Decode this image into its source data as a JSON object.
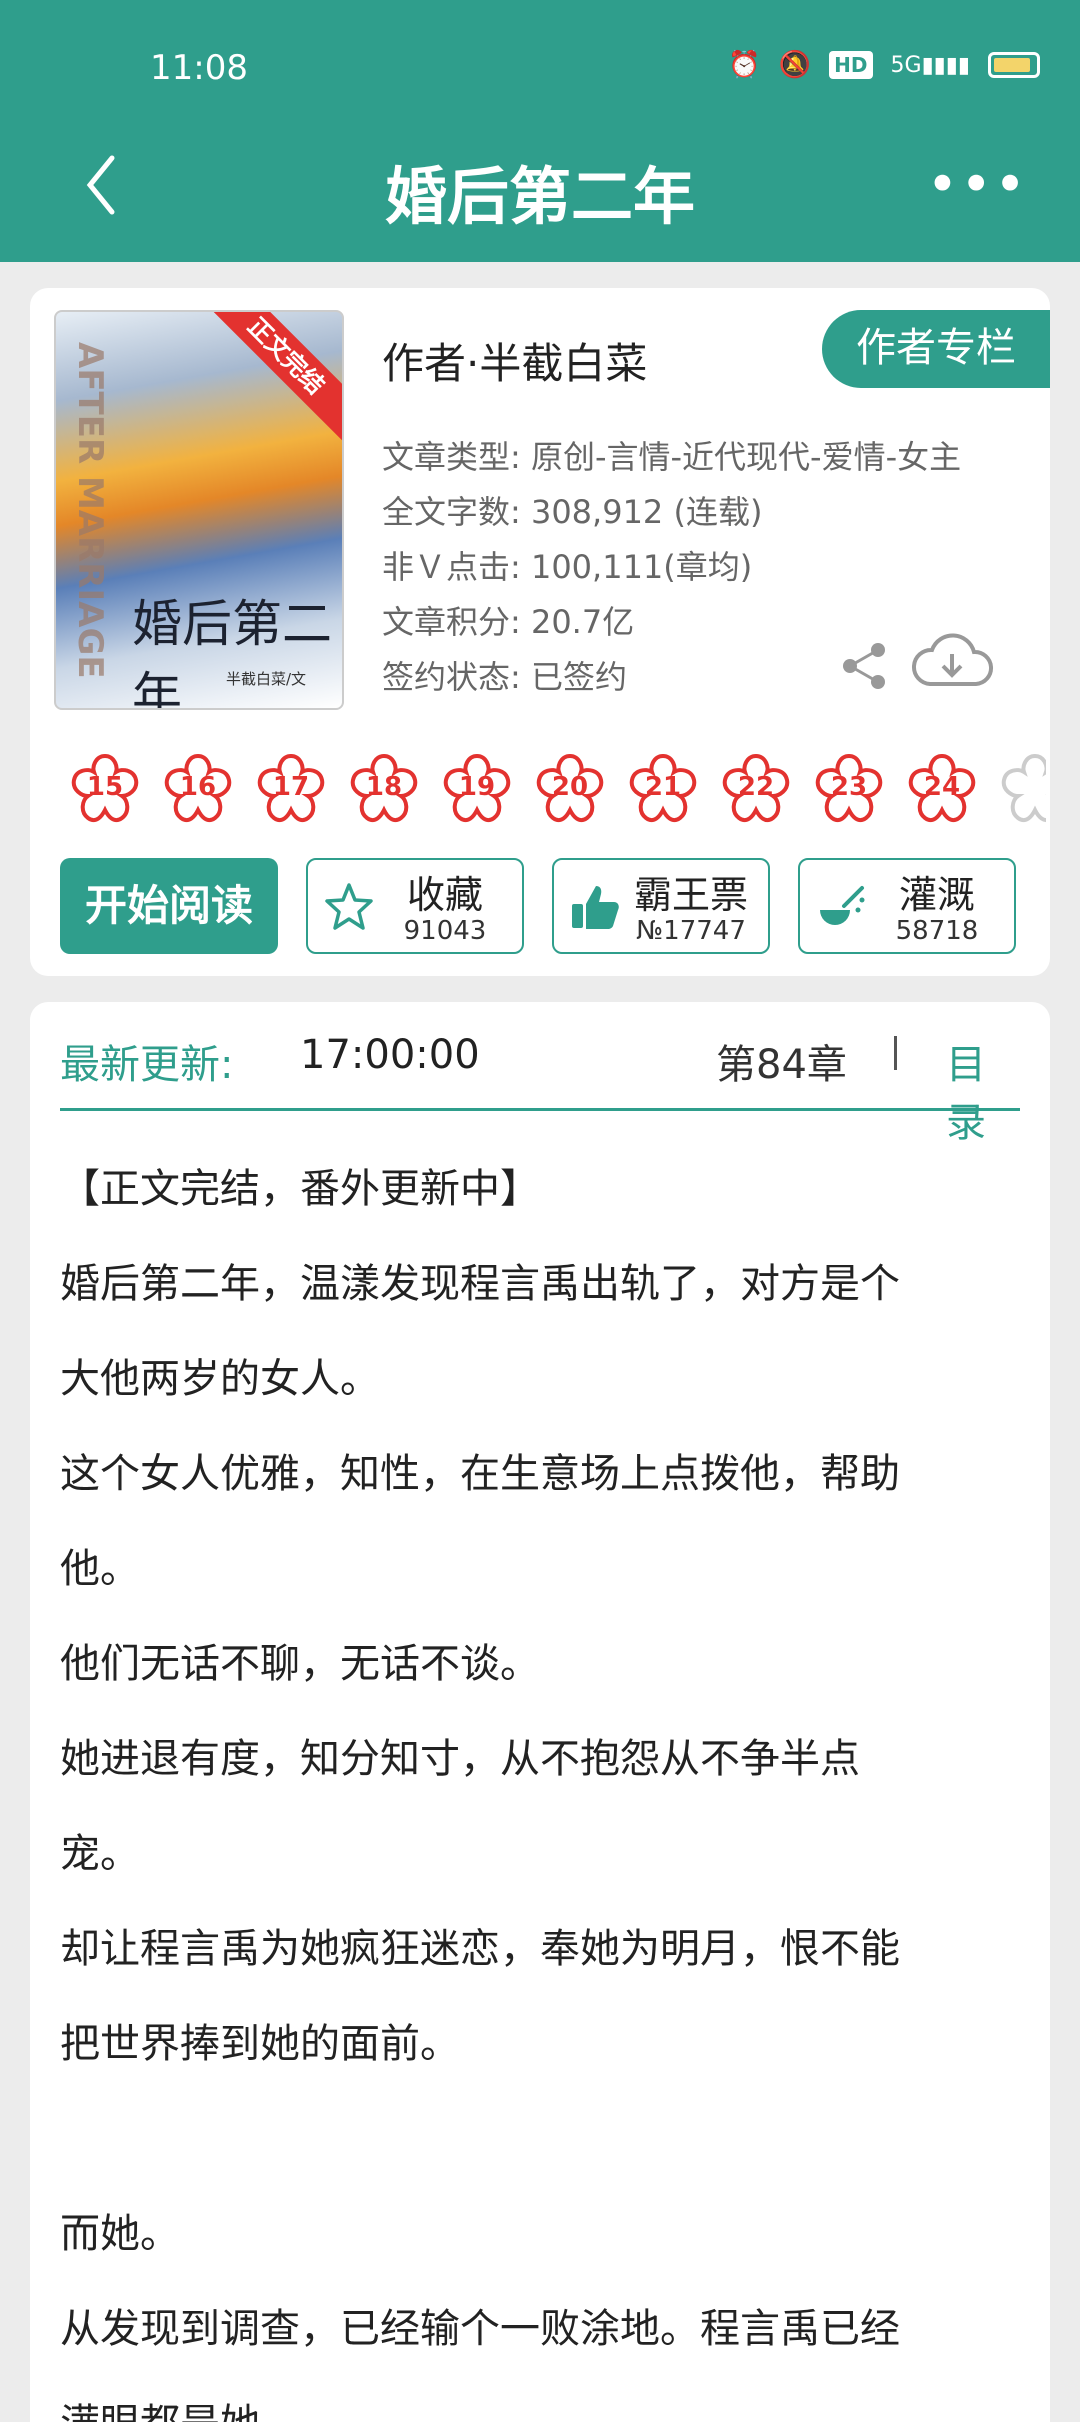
{
  "status_bar": {
    "time": "11:08",
    "hd": "HD",
    "network": "5G"
  },
  "header": {
    "title": "婚后第二年",
    "more": "•••"
  },
  "book": {
    "cover": {
      "ribbon": "正文完结",
      "side_text": "AFTER MARRIAGE",
      "title": "婚后第二年",
      "author": "半截白菜/文"
    },
    "author_line": "作者·半截白菜",
    "author_column_label": "作者专栏",
    "meta": [
      "文章类型: 原创-言情-近代现代-爱情-女主",
      "全文字数: 308,912 (连载)",
      "非Ｖ点击: 100,111(章均)",
      "文章积分: 20.7亿",
      "签约状态: 已签约"
    ],
    "badges": [
      "15",
      "16",
      "17",
      "18",
      "19",
      "20",
      "21",
      "22",
      "23",
      "24"
    ],
    "actions": {
      "read_label": "开始阅读",
      "favorite": {
        "label": "收藏",
        "count": "91043"
      },
      "vote": {
        "label": "霸王票",
        "count": "№17747"
      },
      "water": {
        "label": "灌溉",
        "count": "58718"
      }
    }
  },
  "update": {
    "label": "最新更新:",
    "time": "17:00:00",
    "chapter": "第84章",
    "toc_label": "目录"
  },
  "synopsis": [
    "【正文完结，番外更新中】",
    "婚后第二年，温漾发现程言禹出轨了，对方是个",
    "大他两岁的女人。",
    "这个女人优雅，知性，在生意场上点拨他，帮助",
    "他。",
    "他们无话不聊，无话不谈。",
    "她进退有度，知分知寸，从不抱怨从不争半点",
    "宠。",
    "却让程言禹为她疯狂迷恋，奉她为明月，恨不能",
    "把世界捧到她的面前。",
    "",
    "而她。",
    "从发现到调查，已经输个一败涂地。程言禹已经",
    "满眼都是她。"
  ],
  "colors": {
    "accent": "#2f9e8c",
    "badge_red": "#e3322f",
    "background": "#ececec"
  }
}
